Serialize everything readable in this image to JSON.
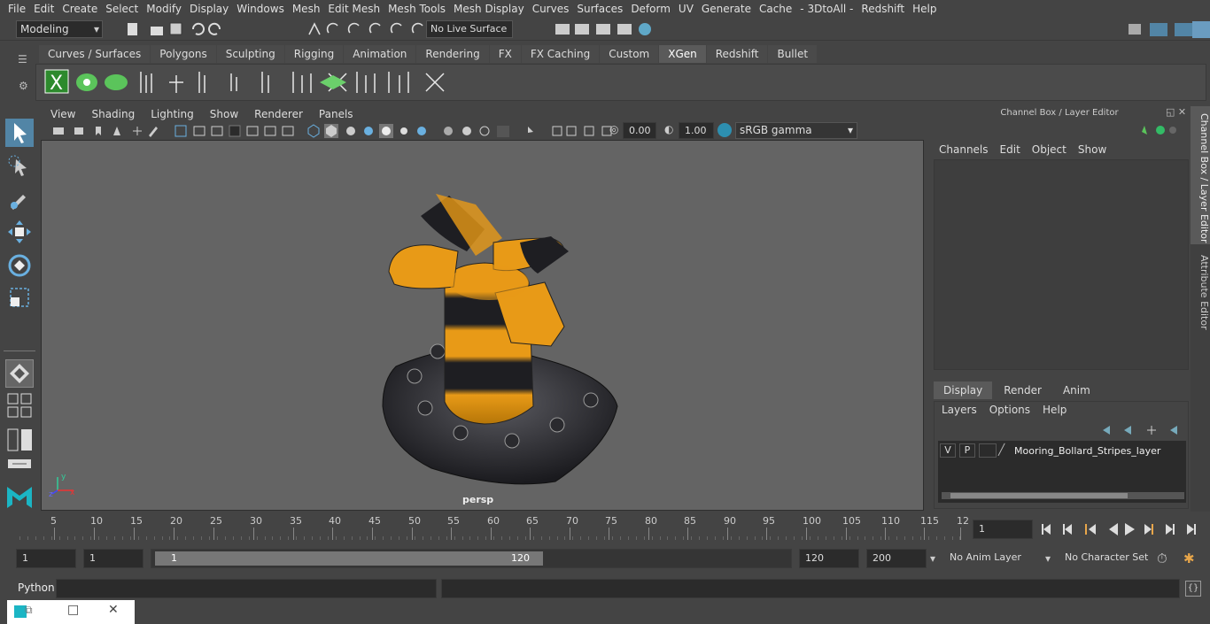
{
  "menubar": [
    "File",
    "Edit",
    "Create",
    "Select",
    "Modify",
    "Display",
    "Windows",
    "Mesh",
    "Edit Mesh",
    "Mesh Tools",
    "Mesh Display",
    "Curves",
    "Surfaces",
    "Deform",
    "UV",
    "Generate",
    "Cache",
    "- 3DtoAll -",
    "Redshift",
    "Help"
  ],
  "status": {
    "mode": "Modeling",
    "live_surface": "No Live Surface"
  },
  "shelf_tabs": [
    "Curves / Surfaces",
    "Polygons",
    "Sculpting",
    "Rigging",
    "Animation",
    "Rendering",
    "FX",
    "FX Caching",
    "Custom",
    "XGen",
    "Redshift",
    "Bullet"
  ],
  "shelf_active": "XGen",
  "viewport": {
    "menu": [
      "View",
      "Shading",
      "Lighting",
      "Show",
      "Renderer",
      "Panels"
    ],
    "exposure": "0.00",
    "gamma": "1.00",
    "color_space": "sRGB gamma",
    "camera_label": "persp"
  },
  "right_panel": {
    "title": "Channel Box / Layer Editor",
    "channel_menu": [
      "Channels",
      "Edit",
      "Object",
      "Show"
    ],
    "layer_tabs": [
      "Display",
      "Render",
      "Anim"
    ],
    "layer_tab_active": "Display",
    "layer_menu": [
      "Layers",
      "Options",
      "Help"
    ],
    "layer": {
      "v": "V",
      "p": "P",
      "name": "Mooring_Bollard_Stripes_layer"
    },
    "side_tabs": [
      "Channel Box / Layer Editor",
      "Attribute Editor"
    ]
  },
  "timeline": {
    "ticks": [
      "5",
      "10",
      "15",
      "20",
      "25",
      "30",
      "35",
      "40",
      "45",
      "50",
      "55",
      "60",
      "65",
      "70",
      "75",
      "80",
      "85",
      "90",
      "95",
      "100",
      "105",
      "110",
      "115",
      "12"
    ],
    "first_label": "1",
    "current_frame": "1"
  },
  "range": {
    "start": "1",
    "playback_start": "1",
    "slider_start": "1",
    "slider_end": "120",
    "playback_end": "120",
    "end": "200",
    "anim_layer": "No Anim Layer",
    "character_set": "No Character Set"
  },
  "cmdline": {
    "label": "Python"
  },
  "colors": {
    "bg": "#444444",
    "viewport": "#646464",
    "accent": "#5285a6",
    "bollard_orange": "#e89a17",
    "bollard_dark": "#1e1e22"
  }
}
